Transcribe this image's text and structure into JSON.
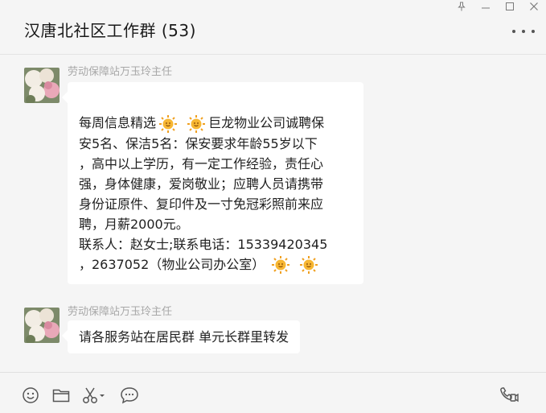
{
  "window": {
    "pin_icon": "pin-icon",
    "minimize_icon": "minimize-icon",
    "maximize_icon": "maximize-icon",
    "close_icon": "close-icon"
  },
  "header": {
    "title": "汉唐北社区工作群 (53)",
    "more_icon": "more-icon"
  },
  "messages": [
    {
      "sender": "劳动保障站万玉玲主任",
      "lines": [
        "每周信息精选",
        "巨龙物业公司诚聘保",
        "安5名、保洁5名：保安要求年龄55岁以下",
        "，高中以上学历，有一定工作经验，责任心",
        "强，身体健康，爱岗敬业；应聘人员请携带",
        "身份证原件、复印件及一寸免冠彩照前来应",
        "聘，月薪2000元。",
        "联系人：赵女士;联系电话：15339420345",
        "，2637052（物业公司办公室）"
      ],
      "emoji": "sun-emoji"
    },
    {
      "sender": "劳动保障站万玉玲主任",
      "text": "请各服务站在居民群 单元长群里转发"
    }
  ],
  "toolbar": {
    "emoji_icon": "emoji-icon",
    "folder_icon": "folder-icon",
    "scissors_icon": "scissors-icon",
    "chat_history_icon": "chat-bubble-icon",
    "video_call_icon": "video-call-icon"
  },
  "colors": {
    "background": "#f5f5f5",
    "bubble": "#ffffff",
    "sender": "#a8a8a8",
    "text": "#1f1f1f"
  }
}
